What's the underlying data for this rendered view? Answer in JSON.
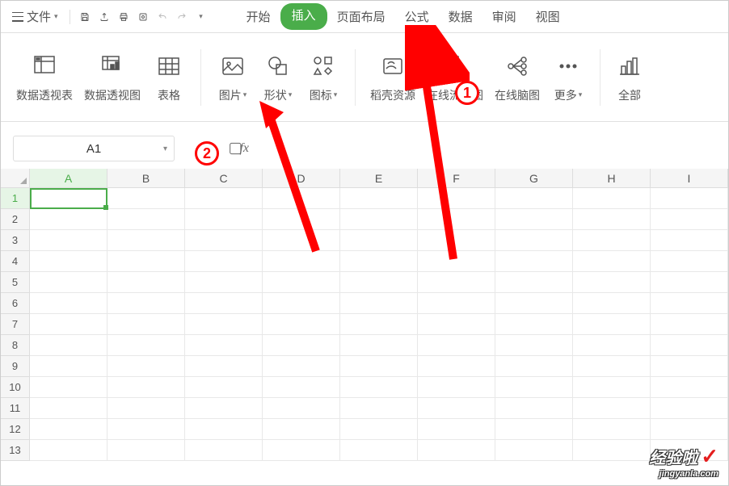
{
  "menu": {
    "file_label": "文件"
  },
  "tabs": {
    "start": "开始",
    "insert": "插入",
    "page_layout": "页面布局",
    "formula": "公式",
    "data": "数据",
    "review": "审阅",
    "view": "视图"
  },
  "ribbon": {
    "pivot_table": "数据透视表",
    "pivot_chart": "数据透视图",
    "table": "表格",
    "picture": "图片",
    "shape": "形状",
    "icon": "图标",
    "resource": "稻壳资源",
    "online_flow": "在线流程图",
    "online_mind": "在线脑图",
    "more": "更多",
    "all": "全部"
  },
  "formula_bar": {
    "cell_ref": "A1"
  },
  "sheet": {
    "cols": [
      "A",
      "B",
      "C",
      "D",
      "E",
      "F",
      "G",
      "H",
      "I"
    ],
    "rows": [
      "1",
      "2",
      "3",
      "4",
      "5",
      "6",
      "7",
      "8",
      "9",
      "10",
      "11",
      "12",
      "13"
    ],
    "active_col": "A",
    "active_row": "1"
  },
  "annotations": {
    "num1": "1",
    "num2": "2"
  },
  "watermark": {
    "line1": "经验啦",
    "line2": "jingyanla.com"
  }
}
